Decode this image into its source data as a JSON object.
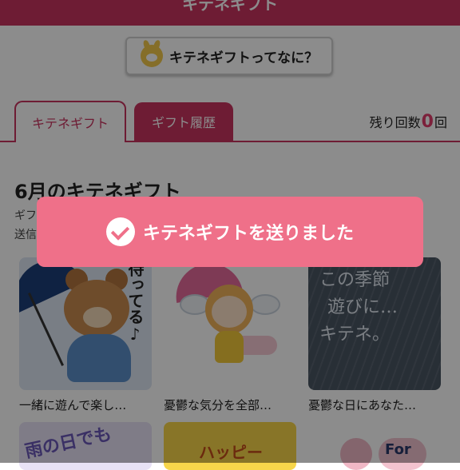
{
  "header": {
    "title": "キテネギフト"
  },
  "about_button": {
    "label": "キテネギフトってなに？",
    "icon": "rabbit-mascot-icon"
  },
  "tabs": [
    {
      "label": "キテネギフト",
      "active": true
    },
    {
      "label": "ギフト履歴",
      "active": false
    }
  ],
  "remaining": {
    "prefix": "残り回数",
    "count": "0",
    "suffix": "回"
  },
  "section": {
    "title": "6月のキテネギフト",
    "description_line1": "ギフ…",
    "description_line2": "送信"
  },
  "gifts": [
    {
      "caption": "一緒に遊んで楽し…",
      "image_text": "待ってる♪"
    },
    {
      "caption": "憂鬱な気分を全部…",
      "image_text": ""
    },
    {
      "caption": "憂鬱な日にあなた…",
      "image_text_line1": "この季節",
      "image_text_line2": "遊びに…",
      "image_text_line3": "キテネ。"
    }
  ],
  "gifts_row2": [
    {
      "image_text": "雨の日でも"
    },
    {
      "image_text": "ハッピー"
    },
    {
      "image_text": "For"
    }
  ],
  "toast": {
    "message": "キテネギフトを送りました",
    "icon": "check-circle-icon"
  },
  "colors": {
    "brand": "#c8335f",
    "toast": "#ef7089",
    "count": "#e23c6c"
  }
}
